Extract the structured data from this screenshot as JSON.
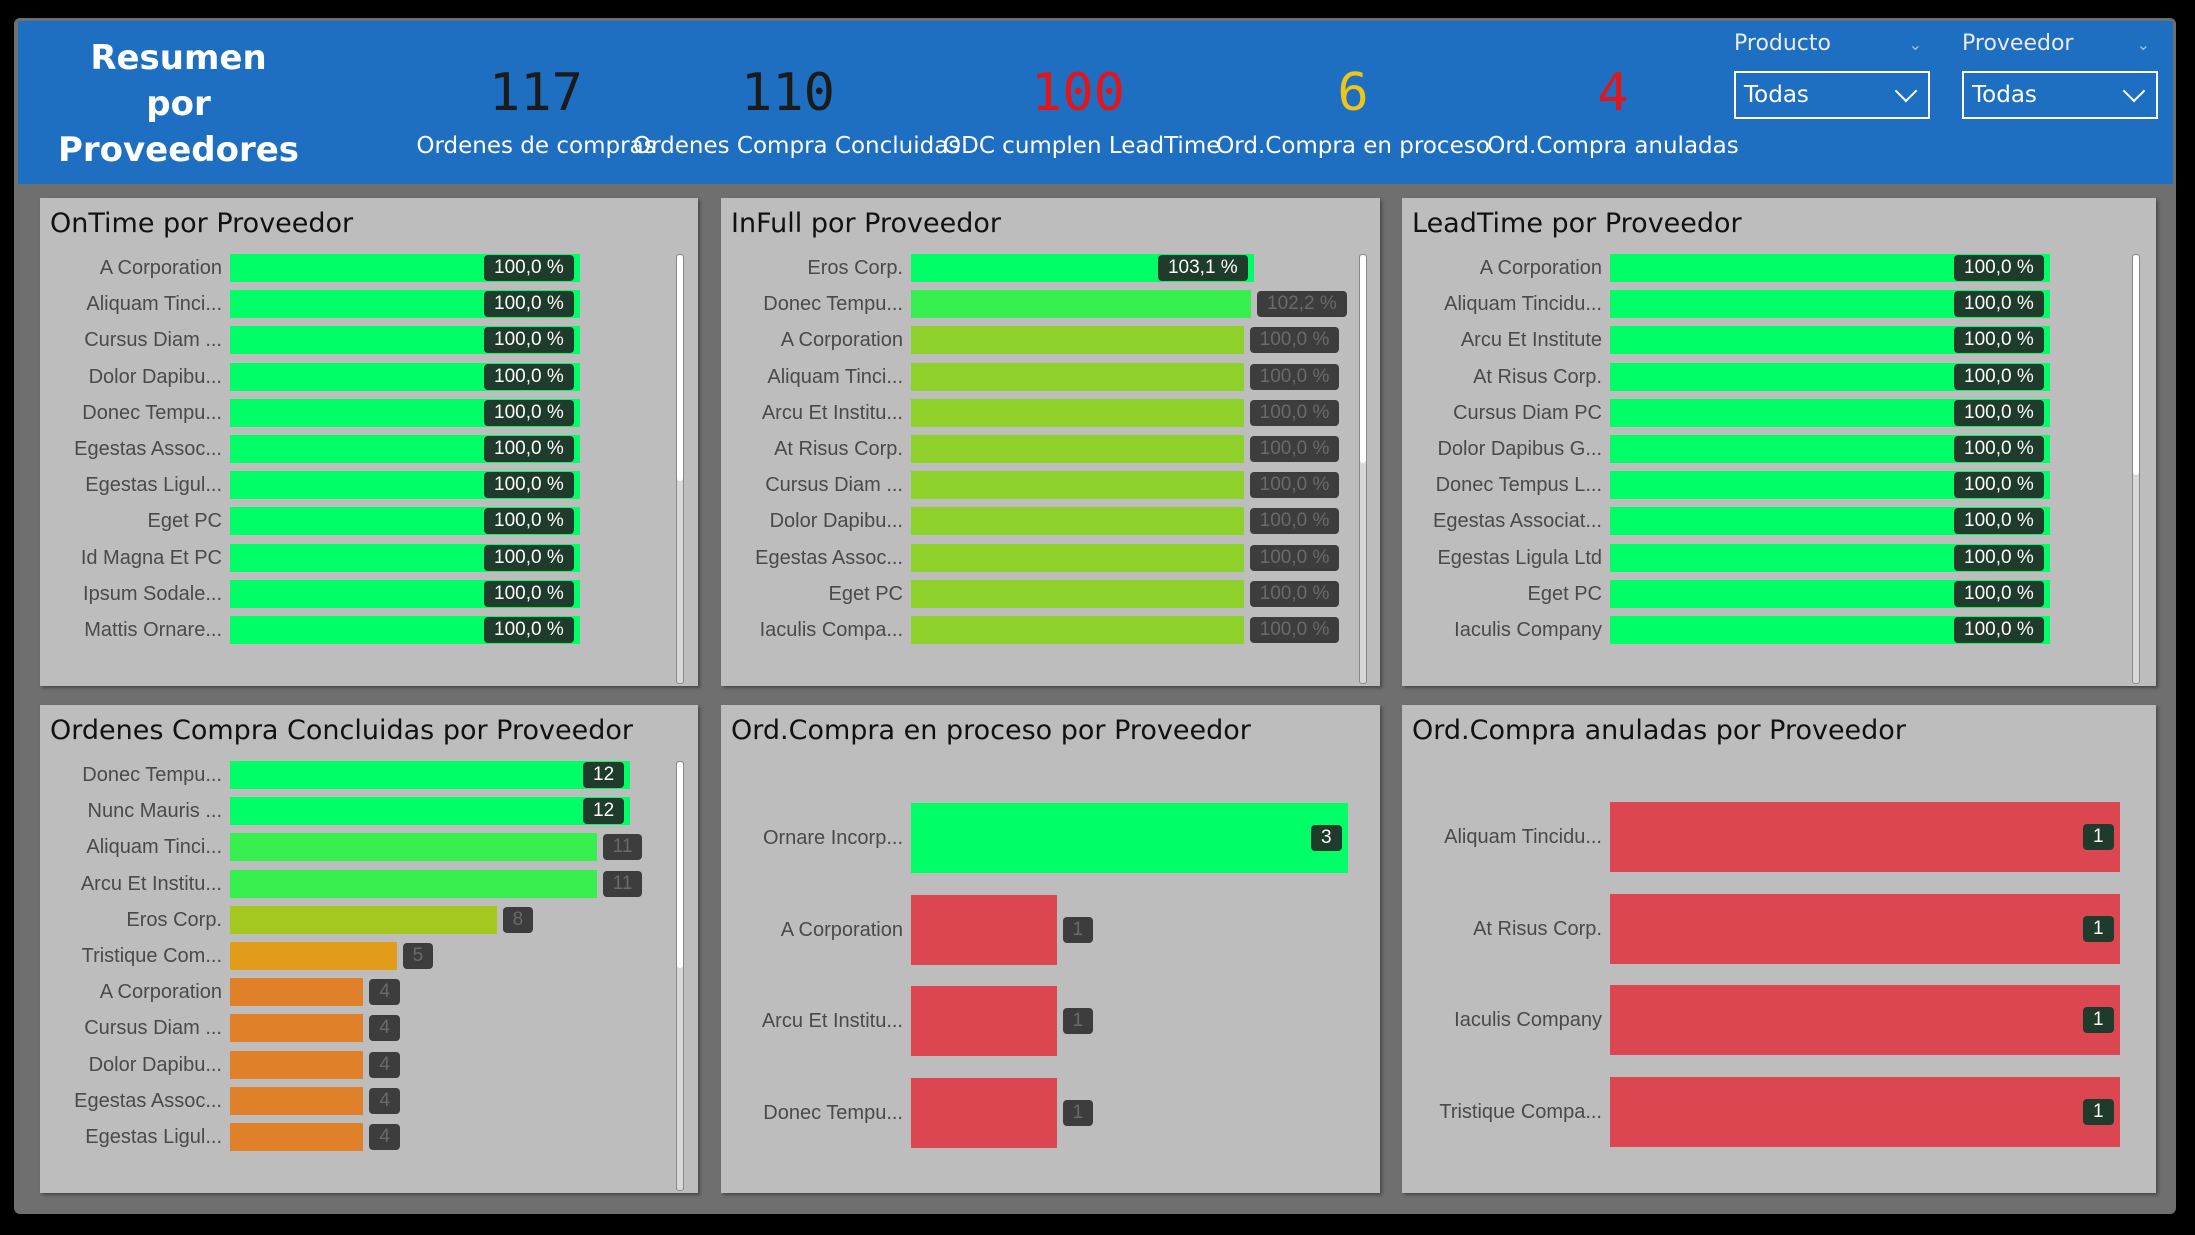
{
  "header": {
    "title_lines": [
      "Resumen",
      "por",
      "Proveedores"
    ],
    "kpis": [
      {
        "value": "117",
        "label": "Ordenes de compras",
        "color": "#1b1b1b"
      },
      {
        "value": "110",
        "label": "Ordenes Compra Concluidas",
        "color": "#1b1b1b"
      },
      {
        "value": "100",
        "label": "ODC cumplen LeadTime",
        "color": "#e0161b"
      },
      {
        "value": "6",
        "label": "Ord.Compra en proceso",
        "color": "#f0c419"
      },
      {
        "value": "4",
        "label": "Ord.Compra anuladas",
        "color": "#e0161b"
      }
    ],
    "slicers": [
      {
        "title": "Producto",
        "value": "Todas"
      },
      {
        "title": "Proveedor",
        "value": "Todas"
      }
    ]
  },
  "colors": {
    "green": "#00ff66",
    "lime_green": "#37f04f",
    "yellow_green": "#8ed12a",
    "olive": "#a4c81d",
    "amber": "#e09c1a",
    "orange": "#e08028",
    "red": "#db4651"
  },
  "panels": [
    {
      "title": "OnTime por Proveedor",
      "max": 100,
      "rows": [
        {
          "name": "A Corporation",
          "value": "100,0 %",
          "num": 100,
          "color": "green",
          "label_style": "dark"
        },
        {
          "name": "Aliquam Tinci...",
          "value": "100,0 %",
          "num": 100,
          "color": "green",
          "label_style": "dark"
        },
        {
          "name": "Cursus Diam ...",
          "value": "100,0 %",
          "num": 100,
          "color": "green",
          "label_style": "dark"
        },
        {
          "name": "Dolor Dapibu...",
          "value": "100,0 %",
          "num": 100,
          "color": "green",
          "label_style": "dark"
        },
        {
          "name": "Donec Tempu...",
          "value": "100,0 %",
          "num": 100,
          "color": "green",
          "label_style": "dark"
        },
        {
          "name": "Egestas Assoc...",
          "value": "100,0 %",
          "num": 100,
          "color": "green",
          "label_style": "dark"
        },
        {
          "name": "Egestas Ligul...",
          "value": "100,0 %",
          "num": 100,
          "color": "green",
          "label_style": "dark"
        },
        {
          "name": "Eget PC",
          "value": "100,0 %",
          "num": 100,
          "color": "green",
          "label_style": "dark"
        },
        {
          "name": "Id Magna Et PC",
          "value": "100,0 %",
          "num": 100,
          "color": "green",
          "label_style": "dark"
        },
        {
          "name": "Ipsum Sodale...",
          "value": "100,0 %",
          "num": 100,
          "color": "green",
          "label_style": "dark"
        },
        {
          "name": "Mattis Ornare...",
          "value": "100,0 %",
          "num": 100,
          "color": "green",
          "label_style": "dark"
        }
      ]
    },
    {
      "title": "InFull por Proveedor",
      "max": 102.2,
      "rows": [
        {
          "name": "Eros Corp.",
          "value": "103,1 %",
          "num": 103.1,
          "color": "green",
          "label_style": "dark"
        },
        {
          "name": "Donec Tempu...",
          "value": "102,2 %",
          "num": 102.2,
          "color": "lime_green",
          "label_style": "dim"
        },
        {
          "name": "A Corporation",
          "value": "100,0 %",
          "num": 100,
          "color": "yellow_green",
          "label_style": "dim"
        },
        {
          "name": "Aliquam Tinci...",
          "value": "100,0 %",
          "num": 100,
          "color": "yellow_green",
          "label_style": "dim"
        },
        {
          "name": "Arcu Et Institu...",
          "value": "100,0 %",
          "num": 100,
          "color": "yellow_green",
          "label_style": "dim"
        },
        {
          "name": "At Risus Corp.",
          "value": "100,0 %",
          "num": 100,
          "color": "yellow_green",
          "label_style": "dim"
        },
        {
          "name": "Cursus Diam ...",
          "value": "100,0 %",
          "num": 100,
          "color": "yellow_green",
          "label_style": "dim"
        },
        {
          "name": "Dolor Dapibu...",
          "value": "100,0 %",
          "num": 100,
          "color": "yellow_green",
          "label_style": "dim"
        },
        {
          "name": "Egestas Assoc...",
          "value": "100,0 %",
          "num": 100,
          "color": "yellow_green",
          "label_style": "dim"
        },
        {
          "name": "Eget PC",
          "value": "100,0 %",
          "num": 100,
          "color": "yellow_green",
          "label_style": "dim"
        },
        {
          "name": "Iaculis Compa...",
          "value": "100,0 %",
          "num": 100,
          "color": "yellow_green",
          "label_style": "dim"
        }
      ]
    },
    {
      "title": "LeadTime por Proveedor",
      "max": 100,
      "rows": [
        {
          "name": "A Corporation",
          "value": "100,0 %",
          "num": 100,
          "color": "green",
          "label_style": "dark"
        },
        {
          "name": "Aliquam Tincidu...",
          "value": "100,0 %",
          "num": 100,
          "color": "green",
          "label_style": "dark"
        },
        {
          "name": "Arcu Et Institute",
          "value": "100,0 %",
          "num": 100,
          "color": "green",
          "label_style": "dark"
        },
        {
          "name": "At Risus Corp.",
          "value": "100,0 %",
          "num": 100,
          "color": "green",
          "label_style": "dark"
        },
        {
          "name": "Cursus Diam PC",
          "value": "100,0 %",
          "num": 100,
          "color": "green",
          "label_style": "dark"
        },
        {
          "name": "Dolor Dapibus G...",
          "value": "100,0 %",
          "num": 100,
          "color": "green",
          "label_style": "dark"
        },
        {
          "name": "Donec Tempus L...",
          "value": "100,0 %",
          "num": 100,
          "color": "green",
          "label_style": "dark"
        },
        {
          "name": "Egestas Associat...",
          "value": "100,0 %",
          "num": 100,
          "color": "green",
          "label_style": "dark"
        },
        {
          "name": "Egestas Ligula Ltd",
          "value": "100,0 %",
          "num": 100,
          "color": "green",
          "label_style": "dark"
        },
        {
          "name": "Eget PC",
          "value": "100,0 %",
          "num": 100,
          "color": "green",
          "label_style": "dark"
        },
        {
          "name": "Iaculis Company",
          "value": "100,0 %",
          "num": 100,
          "color": "green",
          "label_style": "dark"
        }
      ]
    },
    {
      "title": "Ordenes Compra Concluidas por Proveedor",
      "max": 12,
      "rows": [
        {
          "name": "Donec Tempu...",
          "value": "12",
          "num": 12,
          "color": "green",
          "label_style": "dark"
        },
        {
          "name": "Nunc Mauris ...",
          "value": "12",
          "num": 12,
          "color": "green",
          "label_style": "dark"
        },
        {
          "name": "Aliquam Tinci...",
          "value": "11",
          "num": 11,
          "color": "lime_green",
          "label_style": "dim"
        },
        {
          "name": "Arcu Et Institu...",
          "value": "11",
          "num": 11,
          "color": "lime_green",
          "label_style": "dim"
        },
        {
          "name": "Eros Corp.",
          "value": "8",
          "num": 8,
          "color": "olive",
          "label_style": "dim"
        },
        {
          "name": "Tristique Com...",
          "value": "5",
          "num": 5,
          "color": "amber",
          "label_style": "dim"
        },
        {
          "name": "A Corporation",
          "value": "4",
          "num": 4,
          "color": "orange",
          "label_style": "dim"
        },
        {
          "name": "Cursus Diam ...",
          "value": "4",
          "num": 4,
          "color": "orange",
          "label_style": "dim"
        },
        {
          "name": "Dolor Dapibu...",
          "value": "4",
          "num": 4,
          "color": "orange",
          "label_style": "dim"
        },
        {
          "name": "Egestas Assoc...",
          "value": "4",
          "num": 4,
          "color": "orange",
          "label_style": "dim"
        },
        {
          "name": "Egestas Ligul...",
          "value": "4",
          "num": 4,
          "color": "orange",
          "label_style": "dim"
        }
      ]
    },
    {
      "title": "Ord.Compra en proceso por Proveedor",
      "max": 3,
      "rows": [
        {
          "name": "Ornare Incorp...",
          "value": "3",
          "num": 3,
          "color": "green",
          "label_style": "dark"
        },
        {
          "name": "A Corporation",
          "value": "1",
          "num": 1,
          "color": "red",
          "label_style": "dim"
        },
        {
          "name": "Arcu Et Institu...",
          "value": "1",
          "num": 1,
          "color": "red",
          "label_style": "dim"
        },
        {
          "name": "Donec Tempu...",
          "value": "1",
          "num": 1,
          "color": "red",
          "label_style": "dim"
        }
      ]
    },
    {
      "title": "Ord.Compra anuladas por Proveedor",
      "max": 1,
      "rows": [
        {
          "name": "Aliquam Tincidu...",
          "value": "1",
          "num": 1,
          "color": "red",
          "label_style": "dark"
        },
        {
          "name": "At Risus Corp.",
          "value": "1",
          "num": 1,
          "color": "red",
          "label_style": "dark"
        },
        {
          "name": "Iaculis Company",
          "value": "1",
          "num": 1,
          "color": "red",
          "label_style": "dark"
        },
        {
          "name": "Tristique Compa...",
          "value": "1",
          "num": 1,
          "color": "red",
          "label_style": "dark"
        }
      ]
    }
  ]
}
